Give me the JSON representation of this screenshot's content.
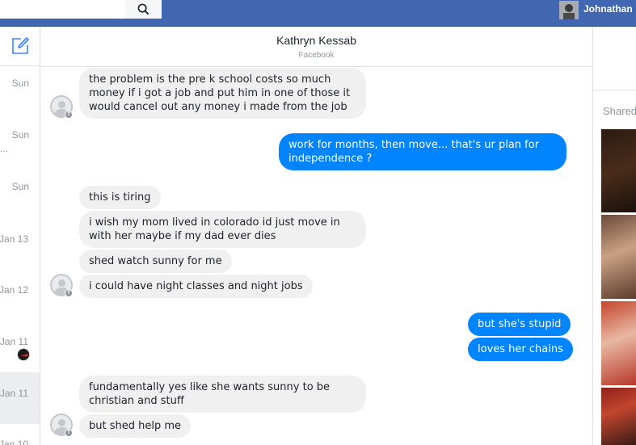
{
  "topbar": {
    "search_value": "",
    "user_name": "Johnathan"
  },
  "sidebar": {
    "dates": [
      "Sun",
      "Sun",
      "Sun",
      "Jan 13",
      "Jan 12",
      "Jan 11",
      "Jan 11",
      "Jan 10"
    ],
    "more": "..."
  },
  "header": {
    "name": "Kathryn Kessab",
    "subtitle": "Facebook"
  },
  "messages": [
    {
      "side": "in",
      "text": "the problem is the pre k school costs so much money if i got a job and put him in one of those it would cancel out any money i made from the job"
    },
    {
      "side": "out",
      "text": "work for months, then move... that's ur plan for independence ?"
    },
    {
      "side": "in",
      "text": "this is tiring"
    },
    {
      "side": "in",
      "text": "i wish my mom lived in colorado id just move in with her maybe if my dad ever dies"
    },
    {
      "side": "in",
      "text": "shed watch sunny for me"
    },
    {
      "side": "in",
      "text": "i could have night classes and night jobs"
    },
    {
      "side": "out",
      "text": "but she's stupid"
    },
    {
      "side": "out",
      "text": "loves her chains"
    },
    {
      "side": "in",
      "text": "fundamentally yes like she wants sunny to be christian and stuff"
    },
    {
      "side": "in",
      "text": "but shed help me"
    }
  ],
  "right_panel": {
    "shared_label": "Shared"
  },
  "colors": {
    "topbar": "#4267b2",
    "outgoing": "#0084ff",
    "incoming": "#f1f0f0"
  }
}
